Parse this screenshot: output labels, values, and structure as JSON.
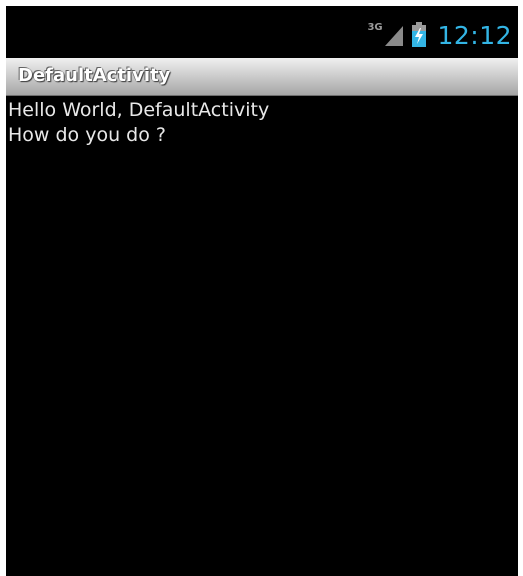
{
  "status_bar": {
    "network_label": "3G",
    "network_icon": "signal-bars-icon",
    "battery_icon": "battery-charging-icon",
    "time": "12:12",
    "accent_color": "#33b5e5"
  },
  "action_bar": {
    "title": "DefaultActivity"
  },
  "content": {
    "lines": [
      "Hello World, DefaultActivity",
      "How do you do ?"
    ]
  }
}
